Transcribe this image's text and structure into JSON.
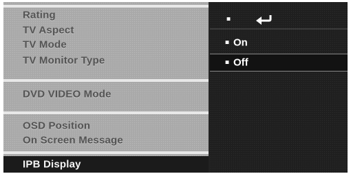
{
  "menu": {
    "items": [
      {
        "label": "Rating"
      },
      {
        "label": "TV Aspect"
      },
      {
        "label": "TV Mode"
      },
      {
        "label": "TV Monitor Type"
      },
      {
        "label": "DVD VIDEO Mode"
      },
      {
        "label": "OSD  Position"
      },
      {
        "label": "On Screen Message"
      },
      {
        "label": "IPB Display"
      }
    ],
    "selected_index": 7
  },
  "options": {
    "return_bullet": "■",
    "return_icon": "return-arrow-icon",
    "items": [
      {
        "bullet": "■",
        "label": "On"
      },
      {
        "bullet": "■",
        "label": "Off"
      }
    ],
    "highlighted_index": 1
  },
  "colors": {
    "menu_bg": "#a9a9a9",
    "menu_text": "#545454",
    "selected_bg": "#1b1b1b",
    "options_bg": "#1f1f1f",
    "options_text": "#ffffff"
  }
}
